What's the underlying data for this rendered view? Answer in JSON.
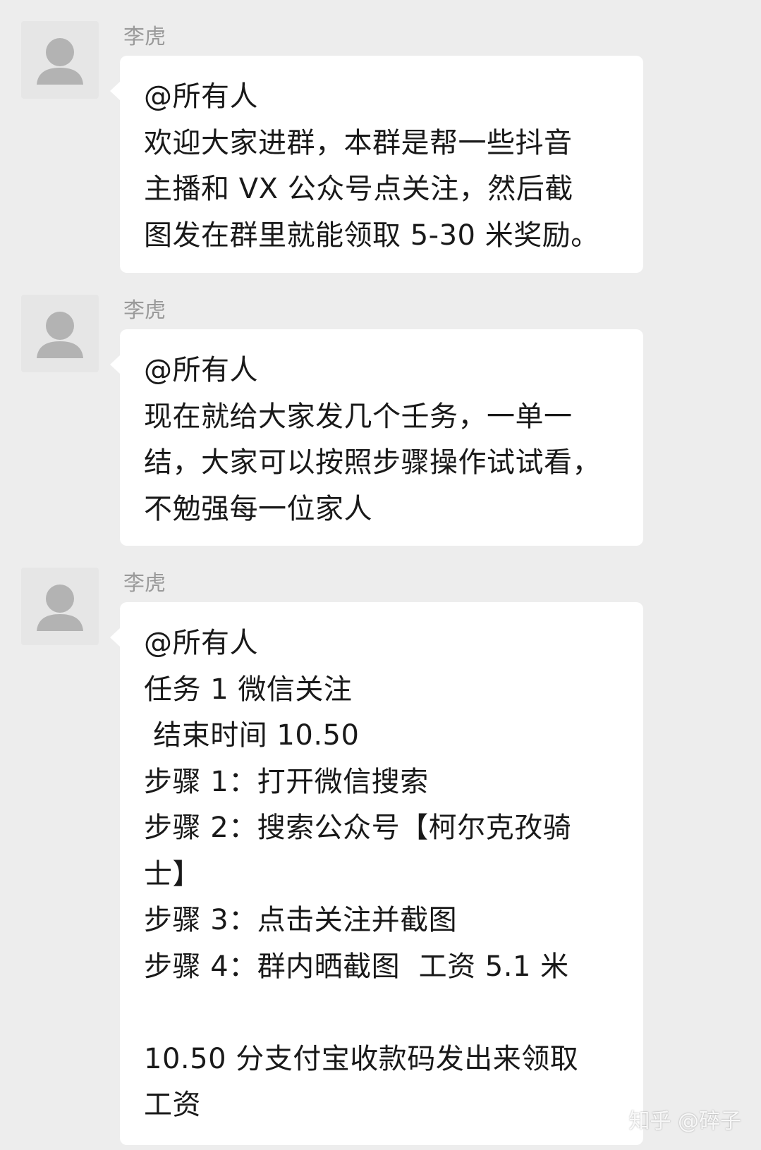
{
  "messages": [
    {
      "sender": "李虎",
      "lines": [
        "@所有人",
        "欢迎大家进群，本群是帮一些抖音",
        "主播和 VX 公众号点关注，然后截",
        "图发在群里就能领取 5-30 米奖励。"
      ]
    },
    {
      "sender": "李虎",
      "lines": [
        "@所有人",
        "现在就给大家发几个壬务，一单一",
        "结，大家可以按照步骤操作试试看，",
        "不勉强每一位家人"
      ]
    },
    {
      "sender": "李虎",
      "lines": [
        "@所有人",
        "任务 1 微信关注",
        " 结束时间 10.50",
        "步骤 1：打开微信搜索",
        "步骤 2：搜索公众号【柯尔克孜骑",
        "士】",
        "步骤 3：点击关注并截图",
        "步骤 4：群内晒截图  工资 5.1 米",
        "",
        "10.50 分支付宝收款码发出来领取",
        "工资"
      ]
    }
  ],
  "watermark": "知乎 @碎子",
  "colors": {
    "background": "#ededed",
    "bubble": "#ffffff",
    "text": "#191919",
    "sender": "#9a9a9a"
  }
}
